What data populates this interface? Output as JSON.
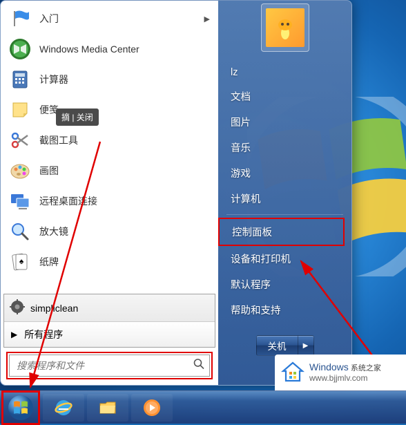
{
  "left_panel": {
    "programs": [
      {
        "label": "入门",
        "icon": "flag",
        "has_submenu": true
      },
      {
        "label": "Windows Media Center",
        "icon": "media-center"
      },
      {
        "label": "计算器",
        "icon": "calculator"
      },
      {
        "label": "便笺",
        "icon": "sticky-notes"
      },
      {
        "label": "截图工具",
        "icon": "snipping"
      },
      {
        "label": "画图",
        "icon": "paint"
      },
      {
        "label": "远程桌面连接",
        "icon": "remote"
      },
      {
        "label": "放大镜",
        "icon": "magnifier"
      },
      {
        "label": "纸牌",
        "icon": "solitaire"
      }
    ],
    "tooltip": "摘 | 关闭",
    "simpliclean_label": "simpliclean",
    "all_programs_label": "所有程序",
    "search_placeholder": "搜索程序和文件"
  },
  "right_panel": {
    "user": "lz",
    "items_top": [
      "文档",
      "图片",
      "音乐",
      "游戏",
      "计算机"
    ],
    "items_bottom": [
      "控制面板",
      "设备和打印机",
      "默认程序",
      "帮助和支持"
    ],
    "highlighted": "控制面板",
    "shutdown_label": "关机"
  },
  "watermark": {
    "title": "Windows",
    "subtitle": "系统之家",
    "url": "www.bjjmlv.com"
  },
  "colors": {
    "highlight": "#e00000"
  }
}
